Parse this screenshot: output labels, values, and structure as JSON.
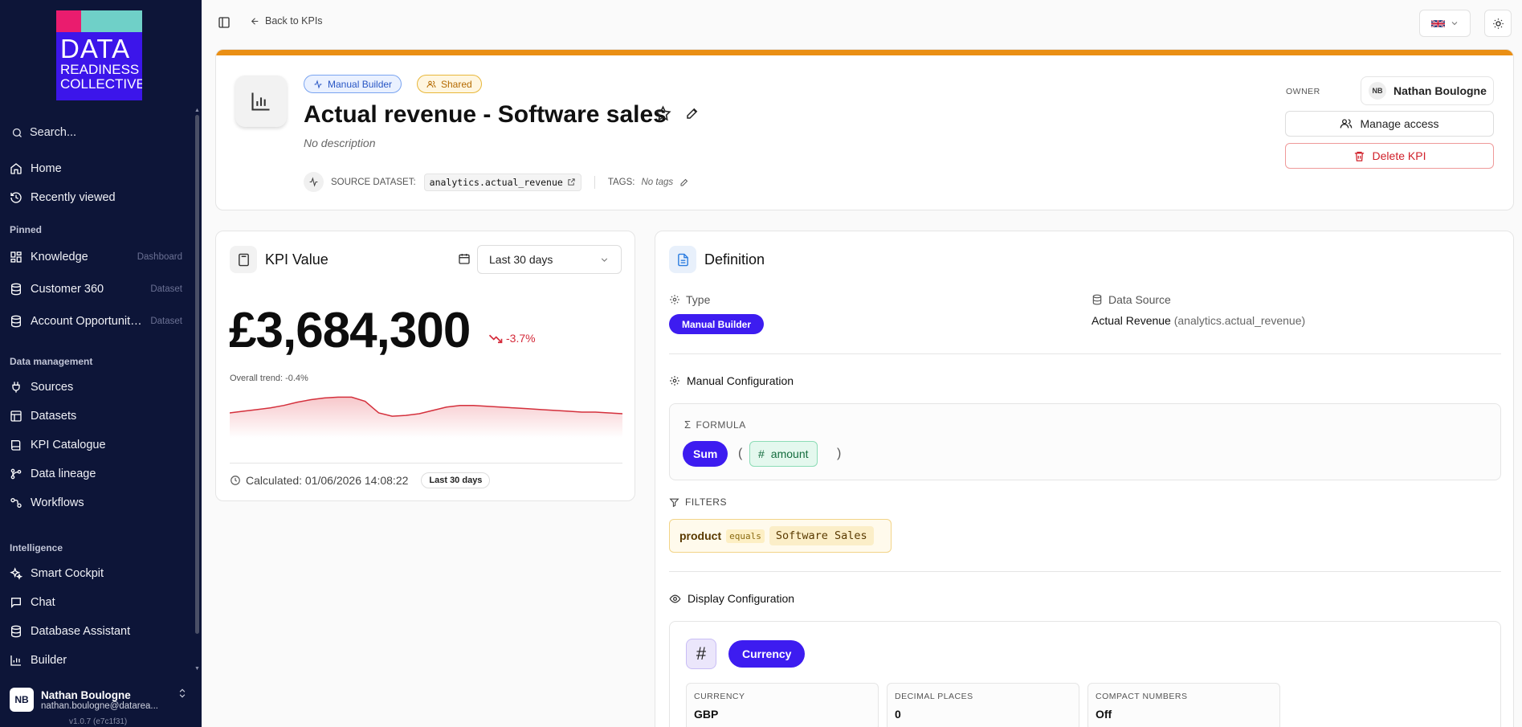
{
  "sidebar": {
    "logo": {
      "line1": "DATA",
      "line2": "READINESS",
      "line3": "COLLECTIVE"
    },
    "search_placeholder": "Search...",
    "top_items": [
      {
        "label": "Home",
        "icon": "home-icon"
      },
      {
        "label": "Recently viewed",
        "icon": "history-icon"
      }
    ],
    "pinned_label": "Pinned",
    "pinned": [
      {
        "label": "Knowledge",
        "tag": "Dashboard"
      },
      {
        "label": "Customer 360",
        "tag": "Dataset"
      },
      {
        "label": "Account Opportunity ...",
        "tag": "Dataset"
      }
    ],
    "data_mgmt_label": "Data management",
    "data_mgmt": [
      {
        "label": "Sources"
      },
      {
        "label": "Datasets"
      },
      {
        "label": "KPI Catalogue"
      },
      {
        "label": "Data lineage"
      },
      {
        "label": "Workflows"
      }
    ],
    "intelligence_label": "Intelligence",
    "intelligence": [
      {
        "label": "Smart Cockpit"
      },
      {
        "label": "Chat"
      },
      {
        "label": "Database Assistant"
      },
      {
        "label": "Builder"
      }
    ],
    "user": {
      "initials": "NB",
      "name": "Nathan Boulogne",
      "email": "nathan.boulogne@datarea..."
    },
    "version": "v1.0.7 (e7c1f31)"
  },
  "topbar": {
    "back_label": "Back to KPIs"
  },
  "header": {
    "accent_color": "#ea8f14",
    "badge_manual": "Manual Builder",
    "badge_shared": "Shared",
    "title": "Actual revenue - Software sales",
    "description": "No description",
    "source_label": "SOURCE DATASET:",
    "source_value": "analytics.actual_revenue",
    "tags_label": "TAGS:",
    "tags_value": "No tags",
    "owner_label": "OWNER",
    "owner_initials": "NB",
    "owner_name": "Nathan Boulogne",
    "manage_access": "Manage access",
    "delete_kpi": "Delete KPI"
  },
  "kpi": {
    "title": "KPI Value",
    "range": "Last 30 days",
    "value": "£3,684,300",
    "delta": "-3.7%",
    "trend_label": "Overall trend: -0.4%",
    "calculated": "Calculated: 01/06/2026 14:08:22",
    "calc_range": "Last 30 days"
  },
  "chart_data": {
    "type": "area",
    "title": "",
    "x": [
      1,
      2,
      3,
      4,
      5,
      6,
      7,
      8,
      9,
      10,
      11,
      12,
      13,
      14,
      15,
      16,
      17,
      18,
      19,
      20,
      21,
      22,
      23,
      24,
      25,
      26,
      27,
      28,
      29,
      30
    ],
    "series": [
      {
        "values": [
          100,
          100.2,
          100.4,
          100.6,
          100.9,
          101.3,
          101.6,
          101.8,
          101.9,
          101.9,
          101.4,
          100,
          99.6,
          99.7,
          99.9,
          100.3,
          100.7,
          100.9,
          100.9,
          100.8,
          100.7,
          100.6,
          100.5,
          100.4,
          100.3,
          100.2,
          100.1,
          100.1,
          100,
          99.9
        ]
      }
    ],
    "ylim": [
      97,
      103
    ],
    "grid": false,
    "line_color": "#d4303c"
  },
  "definition": {
    "title": "Definition",
    "type_label": "Type",
    "type_value": "Manual Builder",
    "ds_label": "Data Source",
    "ds_name": "Actual Revenue",
    "ds_path": "(analytics.actual_revenue)",
    "manual_label": "Manual Configuration",
    "formula_label": "FORMULA",
    "formula_fn": "Sum",
    "paren_open": "(",
    "paren_close": ")",
    "formula_field": "amount",
    "filters_label": "FILTERS",
    "filter_field": "product",
    "filter_op": "equals",
    "filter_value": "Software Sales",
    "display_label": "Display Configuration",
    "display_hash": "#",
    "display_format": "Currency",
    "fields": [
      {
        "label": "CURRENCY",
        "value": "GBP"
      },
      {
        "label": "DECIMAL PLACES",
        "value": "0"
      },
      {
        "label": "COMPACT NUMBERS",
        "value": "Off"
      }
    ]
  }
}
